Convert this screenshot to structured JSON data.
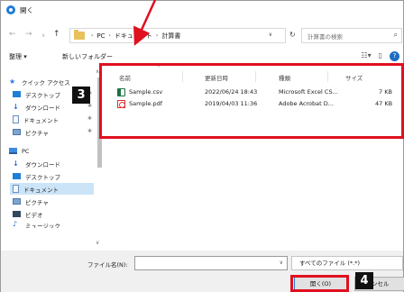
{
  "window": {
    "title": "開く"
  },
  "address": {
    "crumbs": [
      "PC",
      "ドキュメント",
      "計算書"
    ],
    "search_placeholder": "計算書の検索"
  },
  "toolbar": {
    "organize": "整理 ▾",
    "new_folder": "新しいフォルダー"
  },
  "nav": {
    "items": [
      {
        "label": "クイック アクセス",
        "icon": "star-icon"
      },
      {
        "label": "デスクトップ",
        "icon": "desktop-icon",
        "pinned": true
      },
      {
        "label": "ダウンロード",
        "icon": "download-icon",
        "pinned": true
      },
      {
        "label": "ドキュメント",
        "icon": "document-icon",
        "pinned": true
      },
      {
        "label": "ピクチャ",
        "icon": "pictures-icon",
        "pinned": true
      },
      {
        "label": "PC",
        "icon": "pc-icon"
      },
      {
        "label": "ダウンロード",
        "icon": "download-icon"
      },
      {
        "label": "デスクトップ",
        "icon": "desktop-icon"
      },
      {
        "label": "ドキュメント",
        "icon": "document-icon",
        "selected": true
      },
      {
        "label": "ピクチャ",
        "icon": "pictures-icon"
      },
      {
        "label": "ビデオ",
        "icon": "video-icon"
      },
      {
        "label": "ミュージック",
        "icon": "music-icon"
      }
    ]
  },
  "files": {
    "columns": [
      "名前",
      "更新日時",
      "種類",
      "サイズ"
    ],
    "rows": [
      {
        "name": "Sample.csv",
        "modified": "2022/06/24 18:43",
        "type": "Microsoft Excel CS...",
        "size": "7 KB",
        "icon": "csv-file-icon"
      },
      {
        "name": "Sample.pdf",
        "modified": "2019/04/03 11:36",
        "type": "Adobe Acrobat D...",
        "size": "47 KB",
        "icon": "pdf-file-icon"
      }
    ]
  },
  "bottom": {
    "filename_label": "ファイル名(N):",
    "filename_value": "",
    "filetype": "すべてのファイル (*.*)",
    "open_button": "開く(O)",
    "cancel_button": "ンセル"
  },
  "annotations": {
    "badge_3": "3",
    "badge_4": "4",
    "color": "#e0101f"
  }
}
